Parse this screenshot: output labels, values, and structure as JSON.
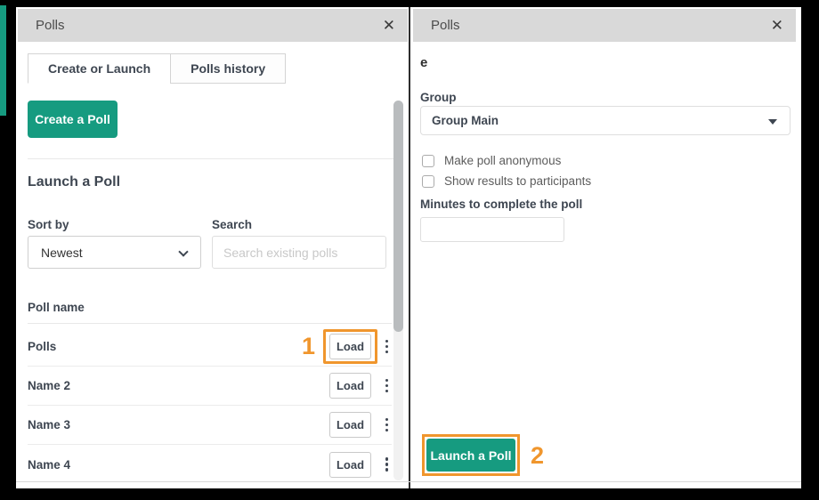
{
  "colors": {
    "accent_teal": "#169b80",
    "highlight_orange": "#f0962d",
    "header_gray": "#d9d9d9",
    "frame_black": "#000000"
  },
  "left_panel": {
    "header": {
      "title": "Polls",
      "close_glyph": "✕"
    },
    "tabs": [
      {
        "label": "Create or Launch",
        "active": true
      },
      {
        "label": "Polls history",
        "active": false
      }
    ],
    "create_button": "Create a Poll",
    "section_title": "Launch a Poll",
    "sort": {
      "label": "Sort by",
      "value": "Newest"
    },
    "search": {
      "label": "Search",
      "placeholder": "Search existing polls"
    },
    "list": {
      "header": "Poll name",
      "rows": [
        {
          "name": "Polls",
          "action": "Load",
          "step": "1"
        },
        {
          "name": "Name 2",
          "action": "Load"
        },
        {
          "name": "Name 3",
          "action": "Load"
        },
        {
          "name": "Name 4",
          "action": "Load"
        }
      ]
    }
  },
  "right_panel": {
    "header": {
      "title": "Polls",
      "close_glyph": "✕"
    },
    "poll_name": "e",
    "group": {
      "label": "Group",
      "value": "Group Main"
    },
    "checkboxes": [
      {
        "label": "Make poll anonymous",
        "checked": false
      },
      {
        "label": "Show results to participants",
        "checked": false
      }
    ],
    "minutes": {
      "label": "Minutes to complete the poll",
      "value": ""
    },
    "launch_button": "Launch a Poll",
    "step": "2"
  }
}
